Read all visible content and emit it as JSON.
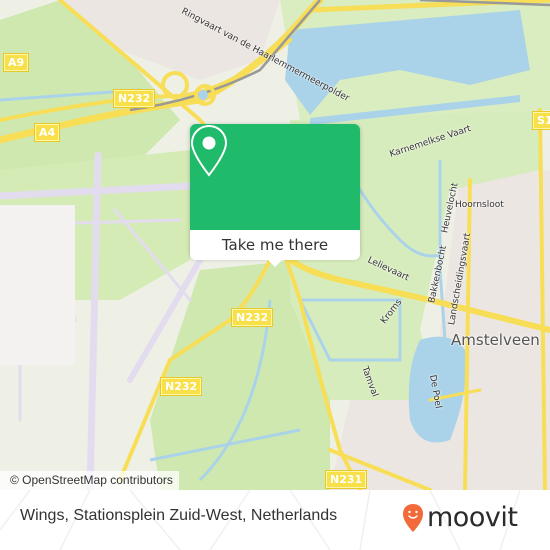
{
  "map": {
    "attribution": "© OpenStreetMap contributors",
    "road_labels": [
      {
        "id": "a9",
        "text": "A9"
      },
      {
        "id": "a4",
        "text": "A4"
      },
      {
        "id": "n232-top",
        "text": "N232"
      },
      {
        "id": "n232-mid",
        "text": "N232"
      },
      {
        "id": "n232-low",
        "text": "N232"
      },
      {
        "id": "n231",
        "text": "N231"
      },
      {
        "id": "s1",
        "text": "S1"
      }
    ],
    "street_labels": [
      {
        "id": "ringvaart",
        "text": "Ringvaart van de Haarlemmermeerpolder"
      },
      {
        "id": "karnemelkse",
        "text": "Karnemelkse Vaart"
      },
      {
        "id": "hornsloot",
        "text": "Hoornsloot"
      },
      {
        "id": "heuvelocht",
        "text": "Heuvelocht"
      },
      {
        "id": "bakkenbocht",
        "text": "Bakkenbocht"
      },
      {
        "id": "lelievaart",
        "text": "Lelievaart"
      },
      {
        "id": "kroms",
        "text": "Kroms"
      },
      {
        "id": "landscheidingsvaart",
        "text": "Landscheidingsvaart"
      },
      {
        "id": "tamval",
        "text": "Tamval"
      },
      {
        "id": "de-poel",
        "text": "De Poel"
      }
    ],
    "city_label": "Amstelveen",
    "colors": {
      "water": "#aad3ea",
      "park": "#cfe8b0",
      "road": "#f7de56",
      "runway": "#e3dcef",
      "urban": "#ece6e2"
    }
  },
  "popup": {
    "button_label": "Take me there",
    "accent_color": "#1fba6a"
  },
  "footer": {
    "location_name": "Wings, Stationsplein Zuid-West, Netherlands",
    "brand": "moovit",
    "brand_color": "#f26a3a"
  }
}
